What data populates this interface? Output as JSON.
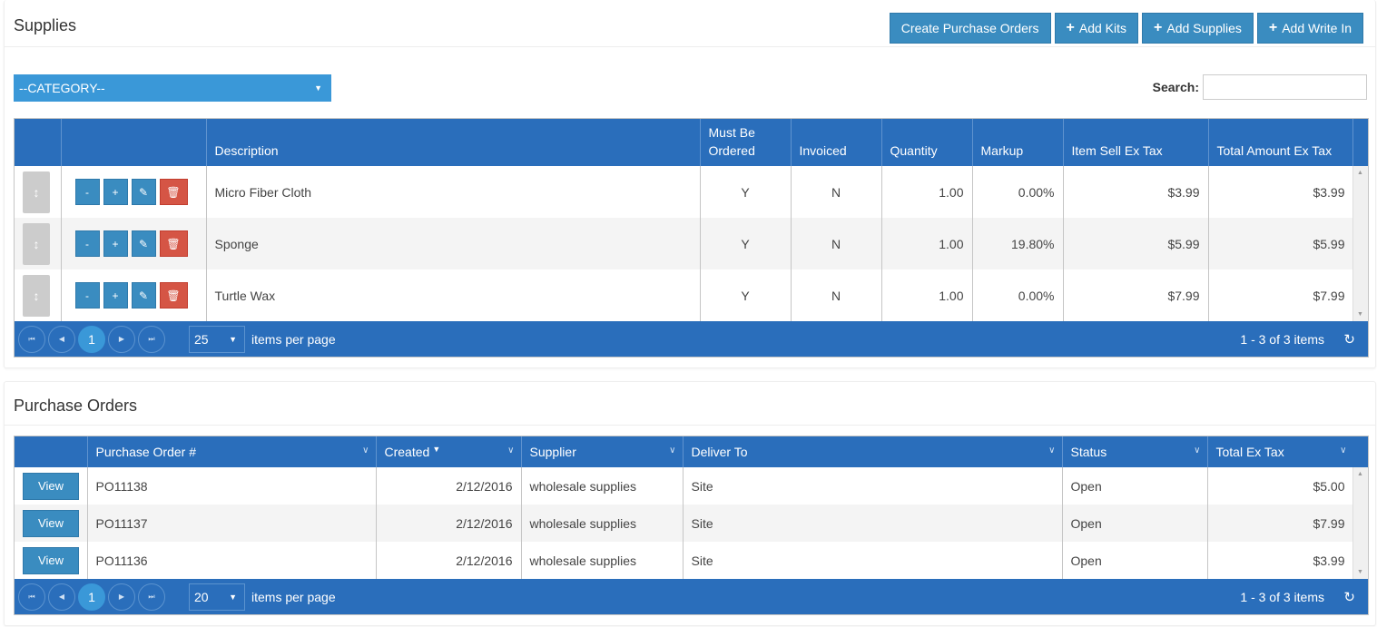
{
  "supplies": {
    "title": "Supplies",
    "toolbar": {
      "create_po_label": "Create Purchase Orders",
      "add_kits_label": "Add Kits",
      "add_supplies_label": "Add Supplies",
      "add_write_in_label": "Add Write In",
      "plus_icon": "+"
    },
    "category_select": {
      "selected": "--CATEGORY--",
      "caret": "▼"
    },
    "search": {
      "label": "Search:",
      "value": "",
      "placeholder": ""
    },
    "columns": [
      "",
      "",
      "Description",
      "Must Be Ordered",
      "Invoiced",
      "Quantity",
      "Markup",
      "Item Sell Ex Tax",
      "Total Amount Ex Tax"
    ],
    "row_action_icons": {
      "drag": "↕",
      "minus": "-",
      "plus": "+",
      "edit": "✎",
      "delete": "🗑"
    },
    "rows": [
      {
        "description": "Micro Fiber Cloth",
        "must_be_ordered": "Y",
        "invoiced": "N",
        "quantity": "1.00",
        "markup": "0.00%",
        "item_sell_ex_tax": "$3.99",
        "total_amount_ex_tax": "$3.99"
      },
      {
        "description": "Sponge",
        "must_be_ordered": "Y",
        "invoiced": "N",
        "quantity": "1.00",
        "markup": "19.80%",
        "item_sell_ex_tax": "$5.99",
        "total_amount_ex_tax": "$5.99"
      },
      {
        "description": "Turtle Wax",
        "must_be_ordered": "Y",
        "invoiced": "N",
        "quantity": "1.00",
        "markup": "0.00%",
        "item_sell_ex_tax": "$7.99",
        "total_amount_ex_tax": "$7.99"
      }
    ],
    "pager": {
      "current_page": "1",
      "page_size": "25",
      "items_per_page_label": "items per page",
      "info": "1 - 3 of 3 items"
    }
  },
  "purchase_orders": {
    "title": "Purchase Orders",
    "columns": [
      "",
      "Purchase Order #",
      "Created",
      "Supplier",
      "Deliver To",
      "Status",
      "Total Ex Tax"
    ],
    "sorted_column": "Created",
    "view_label": "View",
    "rows": [
      {
        "po_number": "PO11138",
        "created": "2/12/2016",
        "supplier": "wholesale supplies",
        "deliver_to": "Site",
        "status": "Open",
        "total_ex_tax": "$5.00"
      },
      {
        "po_number": "PO11137",
        "created": "2/12/2016",
        "supplier": "wholesale supplies",
        "deliver_to": "Site",
        "status": "Open",
        "total_ex_tax": "$7.99"
      },
      {
        "po_number": "PO11136",
        "created": "2/12/2016",
        "supplier": "wholesale supplies",
        "deliver_to": "Site",
        "status": "Open",
        "total_ex_tax": "$3.99"
      }
    ],
    "pager": {
      "current_page": "1",
      "page_size": "20",
      "items_per_page_label": "items per page",
      "info": "1 - 3 of 3 items"
    }
  },
  "pager_icons": {
    "first": "⏮",
    "prev": "◀",
    "next": "▶",
    "last": "⏭",
    "refresh": "↻",
    "caret": "▼"
  },
  "colors": {
    "header_blue": "#2a6ebb",
    "button_blue": "#3a8cc0",
    "category_blue": "#3a98d8",
    "danger_red": "#d55545",
    "drag_gray": "#cccccc"
  }
}
